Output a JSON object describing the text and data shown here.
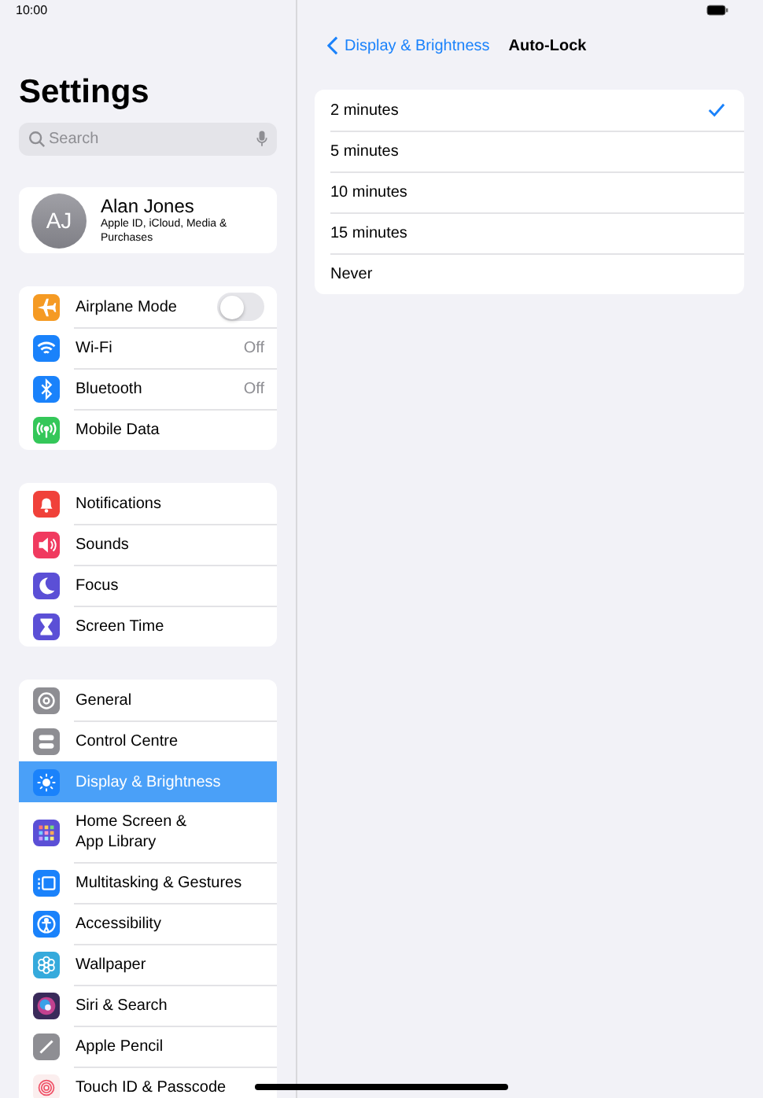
{
  "status_bar": {
    "time": "10:00"
  },
  "sidebar": {
    "title": "Settings",
    "search": {
      "placeholder": "Search"
    },
    "account": {
      "initials": "AJ",
      "name": "Alan Jones",
      "subtitle": "Apple ID, iCloud, Media & Purchases"
    },
    "groups": [
      {
        "items": [
          {
            "label": "Airplane Mode",
            "color": "#f59a23",
            "kind": "toggle",
            "on": false,
            "selected": false
          },
          {
            "label": "Wi-Fi",
            "color": "#1a82fb",
            "kind": "value",
            "value": "Off",
            "selected": false
          },
          {
            "label": "Bluetooth",
            "color": "#1a82fb",
            "kind": "value",
            "value": "Off",
            "selected": false
          },
          {
            "label": "Mobile Data",
            "color": "#34c759",
            "kind": "plain",
            "selected": false
          }
        ]
      },
      {
        "items": [
          {
            "label": "Notifications",
            "color": "#f0413a",
            "kind": "plain",
            "selected": false
          },
          {
            "label": "Sounds",
            "color": "#f03a5f",
            "kind": "plain",
            "selected": false
          },
          {
            "label": "Focus",
            "color": "#5b4fd6",
            "kind": "plain",
            "selected": false
          },
          {
            "label": "Screen Time",
            "color": "#5b4fd6",
            "kind": "plain",
            "selected": false
          }
        ]
      },
      {
        "items": [
          {
            "label": "General",
            "color": "#8e8e93",
            "kind": "plain",
            "selected": false
          },
          {
            "label": "Control Centre",
            "color": "#8e8e93",
            "kind": "plain",
            "selected": false
          },
          {
            "label": "Display & Brightness",
            "color": "#1a82fb",
            "kind": "plain",
            "selected": true
          },
          {
            "label": "Home Screen &\nApp Library",
            "color": "#5b4fd6",
            "kind": "plain",
            "selected": false
          },
          {
            "label": "Multitasking & Gestures",
            "color": "#1a82fb",
            "kind": "plain",
            "selected": false
          },
          {
            "label": "Accessibility",
            "color": "#1a82fb",
            "kind": "plain",
            "selected": false
          },
          {
            "label": "Wallpaper",
            "color": "#35aadc",
            "kind": "plain",
            "selected": false
          },
          {
            "label": "Siri & Search",
            "color": "#3a2a5a",
            "kind": "plain",
            "selected": false
          },
          {
            "label": "Apple Pencil",
            "color": "#8e8e93",
            "kind": "plain",
            "selected": false
          },
          {
            "label": "Touch ID & Passcode",
            "color": "#fbeeee",
            "kind": "plain",
            "selected": false
          }
        ]
      }
    ]
  },
  "detail": {
    "back": "Display & Brightness",
    "title": "Auto-Lock",
    "options": [
      {
        "label": "2 minutes",
        "selected": true
      },
      {
        "label": "5 minutes",
        "selected": false
      },
      {
        "label": "10 minutes",
        "selected": false
      },
      {
        "label": "15 minutes",
        "selected": false
      },
      {
        "label": "Never",
        "selected": false
      }
    ]
  }
}
